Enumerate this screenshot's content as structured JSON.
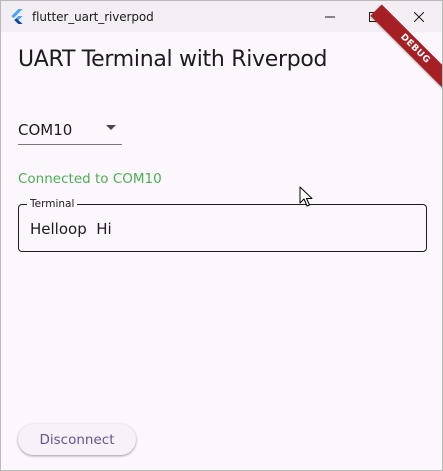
{
  "window": {
    "title": "flutter_uart_riverpod",
    "controls": {
      "minimize_icon": "minimize-icon",
      "maximize_icon": "maximize-icon",
      "close_icon": "close-icon"
    }
  },
  "appbar": {
    "title": "UART Terminal with Riverpod"
  },
  "debug_banner": {
    "label": "DEBUG",
    "color": "#a51f24"
  },
  "port_dropdown": {
    "selected": "COM10"
  },
  "status": {
    "text": "Connected to COM10",
    "color": "#4caf50"
  },
  "terminal": {
    "label": "Terminal",
    "value": "Helloop  Hi"
  },
  "actions": {
    "disconnect_label": "Disconnect"
  },
  "colors": {
    "accent": "#65558f",
    "background": "#fcf7fd"
  }
}
